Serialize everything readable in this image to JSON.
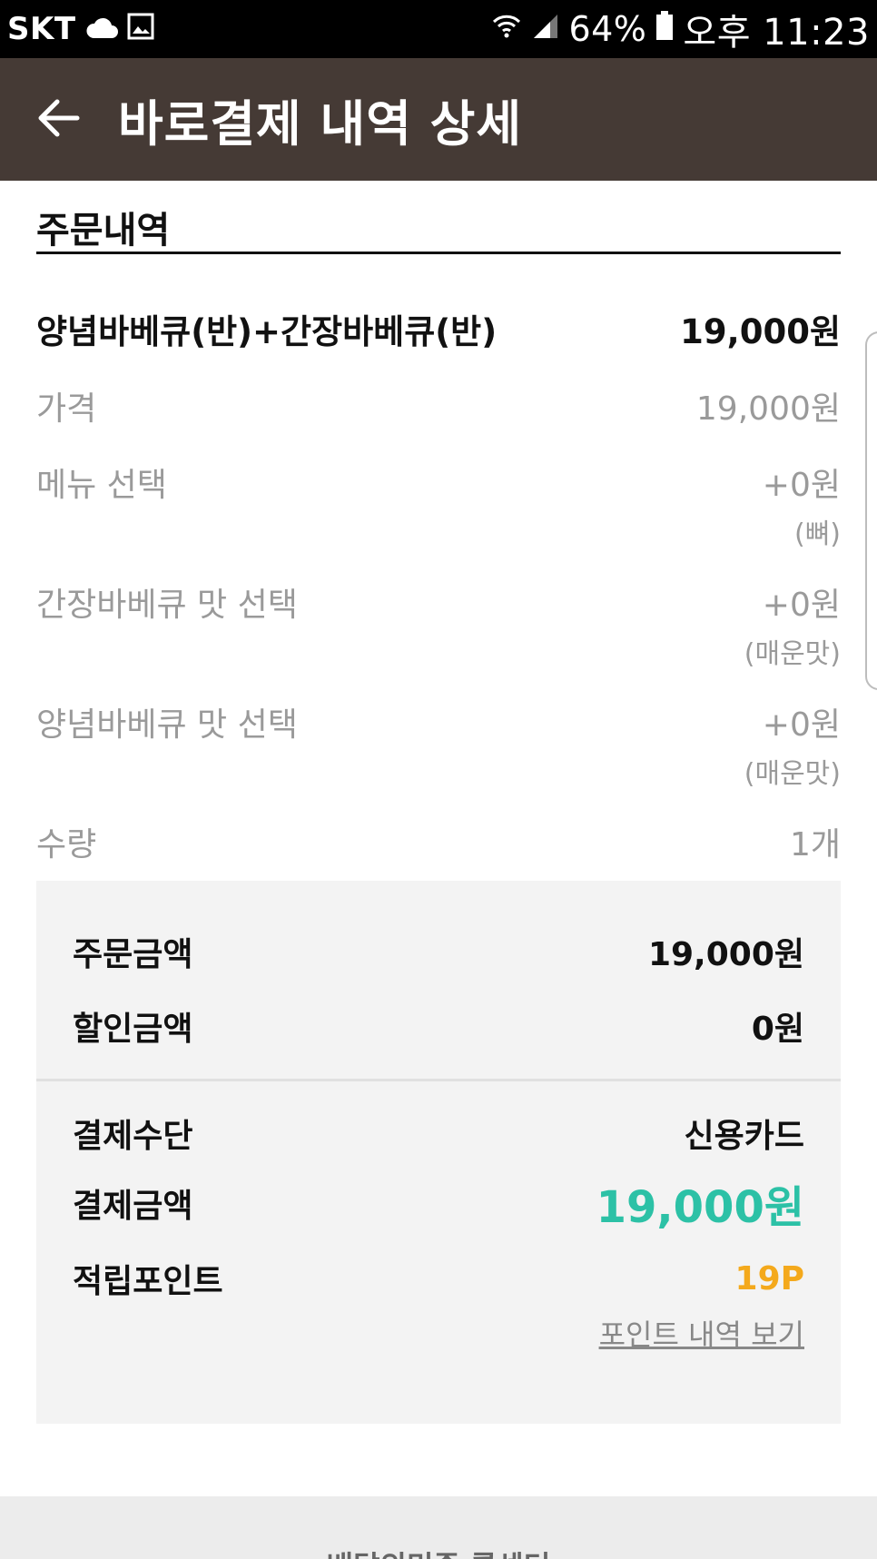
{
  "status_bar": {
    "carrier": "SKT",
    "icons_left": [
      "cloud-icon",
      "image-icon"
    ],
    "icons_right": [
      "wifi-icon",
      "signal-icon",
      "battery-icon"
    ],
    "battery": "64%",
    "time": "오후 11:23"
  },
  "header": {
    "title": "바로결제 내역 상세",
    "back_icon": "arrow-left-icon"
  },
  "order": {
    "section_title": "주문내역",
    "item_name": "양념바베큐(반)+간장바베큐(반)",
    "item_total": "19,000원",
    "options": [
      {
        "label": "가격",
        "value": "19,000원",
        "sub": ""
      },
      {
        "label": "메뉴 선택",
        "value": "+0원",
        "sub": "(뼈)"
      },
      {
        "label": "간장바베큐 맛 선택",
        "value": "+0원",
        "sub": "(매운맛)"
      },
      {
        "label": "양념바베큐 맛 선택",
        "value": "+0원",
        "sub": "(매운맛)"
      },
      {
        "label": "수량",
        "value": "1개",
        "sub": ""
      }
    ]
  },
  "summary": {
    "order_amount_label": "주문금액",
    "order_amount": "19,000원",
    "discount_label": "할인금액",
    "discount": "0원",
    "payment_method_label": "결제수단",
    "payment_method": "신용카드",
    "payment_amount_label": "결제금액",
    "payment_amount": "19,000원",
    "points_label": "적립포인트",
    "points": "19P",
    "points_link": "포인트 내역 보기",
    "colors": {
      "payment_amount": "#2cc1a6",
      "points": "#f4a91c"
    }
  },
  "footer": {
    "text": "배달의민족 콜센터"
  }
}
